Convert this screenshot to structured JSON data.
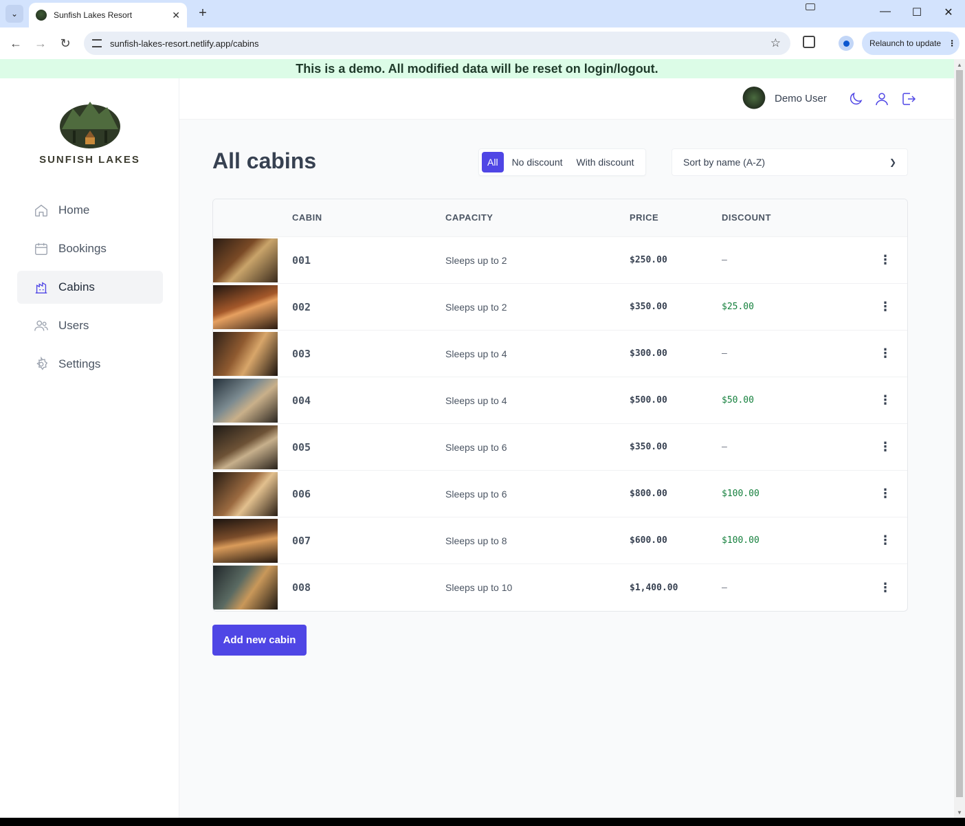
{
  "browser": {
    "tab_title": "Sunfish Lakes Resort",
    "url": "sunfish-lakes-resort.netlify.app/cabins",
    "relaunch_label": "Relaunch to update"
  },
  "banner": "This is a demo. All modified data will be reset on login/logout.",
  "sidebar": {
    "logo_text": "SUNFISH LAKES",
    "items": [
      {
        "label": "Home",
        "icon": "home-icon"
      },
      {
        "label": "Bookings",
        "icon": "calendar-icon"
      },
      {
        "label": "Cabins",
        "icon": "cabins-icon",
        "active": true
      },
      {
        "label": "Users",
        "icon": "users-icon"
      },
      {
        "label": "Settings",
        "icon": "gear-icon"
      }
    ]
  },
  "header": {
    "user_name": "Demo User"
  },
  "main": {
    "title": "All cabins",
    "filters": [
      "All",
      "No discount",
      "With discount"
    ],
    "active_filter": "All",
    "sort_value": "Sort by name (A-Z)",
    "columns": [
      "CABIN",
      "CAPACITY",
      "PRICE",
      "DISCOUNT"
    ],
    "rows": [
      {
        "name": "001",
        "capacity": "Sleeps up to 2",
        "price": "$250.00",
        "discount": "—"
      },
      {
        "name": "002",
        "capacity": "Sleeps up to 2",
        "price": "$350.00",
        "discount": "$25.00"
      },
      {
        "name": "003",
        "capacity": "Sleeps up to 4",
        "price": "$300.00",
        "discount": "—"
      },
      {
        "name": "004",
        "capacity": "Sleeps up to 4",
        "price": "$500.00",
        "discount": "$50.00"
      },
      {
        "name": "005",
        "capacity": "Sleeps up to 6",
        "price": "$350.00",
        "discount": "—"
      },
      {
        "name": "006",
        "capacity": "Sleeps up to 6",
        "price": "$800.00",
        "discount": "$100.00"
      },
      {
        "name": "007",
        "capacity": "Sleeps up to 8",
        "price": "$600.00",
        "discount": "$100.00"
      },
      {
        "name": "008",
        "capacity": "Sleeps up to 10",
        "price": "$1,400.00",
        "discount": "—"
      }
    ],
    "add_button": "Add new cabin"
  },
  "colors": {
    "accent": "#4f46e5",
    "discount": "#15803d",
    "banner_bg": "#dcfce7"
  }
}
